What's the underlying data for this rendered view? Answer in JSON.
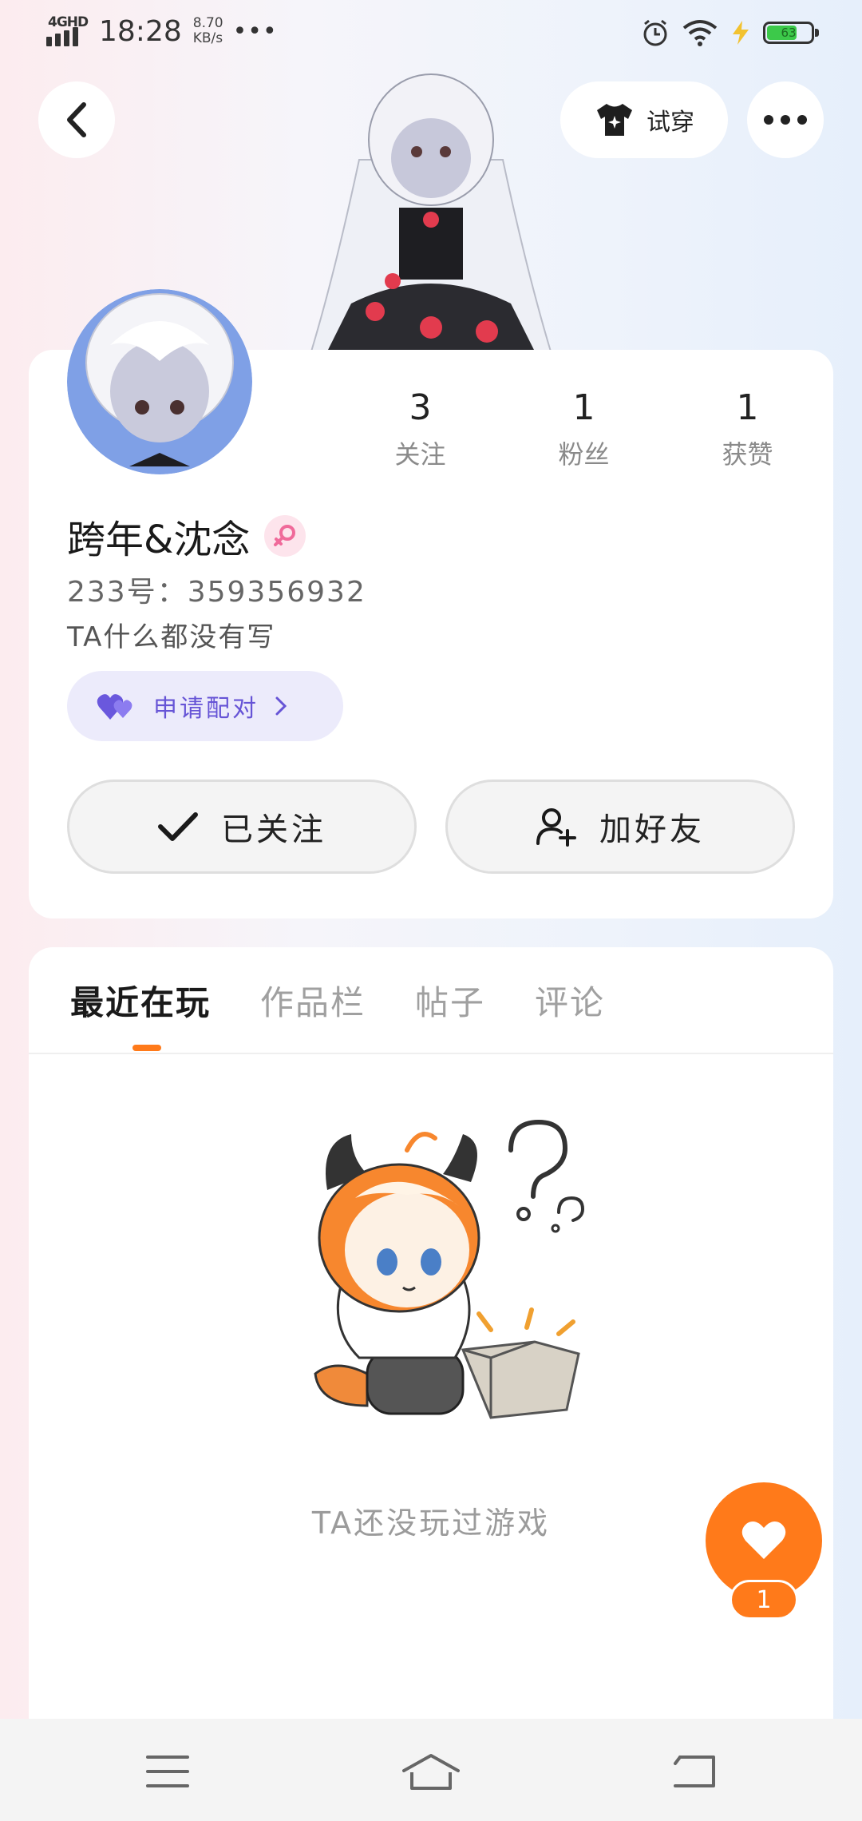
{
  "status_bar": {
    "network": "4GHD",
    "time": "18:28",
    "speed_value": "8.70",
    "speed_unit": "KB/s",
    "more": "•••",
    "battery": "63"
  },
  "top_bar": {
    "back_icon": "chevron-left-icon",
    "tryon_label": "试穿",
    "more_icon": "more-dots-icon"
  },
  "profile": {
    "stats": [
      {
        "value": "3",
        "label": "关注"
      },
      {
        "value": "1",
        "label": "粉丝"
      },
      {
        "value": "1",
        "label": "获赞"
      }
    ],
    "username": "跨年&沈念",
    "gender_icon": "female-icon",
    "uid": "233号：359356932",
    "bio": "TA什么都没有写",
    "pair_label": "申请配对",
    "follow_label": "已关注",
    "add_friend_label": "加好友"
  },
  "tabs": [
    "最近在玩",
    "作品栏",
    "帖子",
    "评论"
  ],
  "active_tab": "最近在玩",
  "empty_state": {
    "text": "TA还没玩过游戏"
  },
  "like": {
    "count": "1"
  },
  "colors": {
    "accent": "#ff7a1a",
    "pair_text": "#6654d6",
    "pair_bg": "#ecebfb"
  }
}
